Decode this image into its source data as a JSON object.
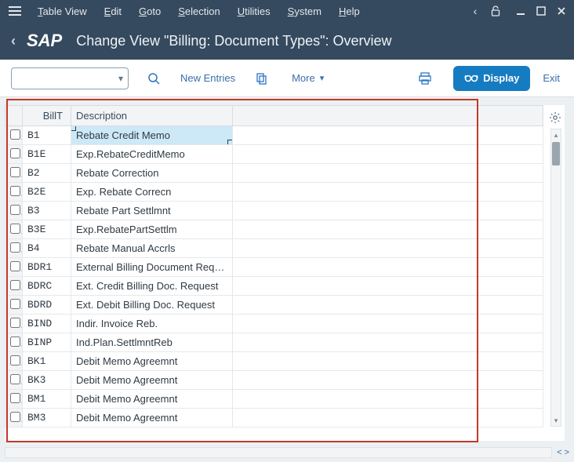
{
  "menubar": {
    "items": [
      {
        "label": "Table View",
        "ul": "T",
        "rest": "able View"
      },
      {
        "label": "Edit",
        "ul": "E",
        "rest": "dit"
      },
      {
        "label": "Goto",
        "ul": "G",
        "rest": "oto"
      },
      {
        "label": "Selection",
        "ul": "S",
        "rest": "election"
      },
      {
        "label": "Utilities",
        "ul": "U",
        "rest": "tilities"
      },
      {
        "label": "System",
        "ul": "S",
        "rest": "ystem"
      },
      {
        "label": "Help",
        "ul": "H",
        "rest": "elp"
      }
    ]
  },
  "header": {
    "logo": "SAP",
    "title": "Change View \"Billing: Document Types\": Overview"
  },
  "toolbar": {
    "combo_value": "",
    "new_entries": "New Entries",
    "more": "More",
    "display": "Display",
    "exit": "Exit"
  },
  "table": {
    "columns": {
      "billt": "BillT",
      "description": "Description"
    },
    "rows": [
      {
        "billt": "B1",
        "desc": "Rebate Credit Memo",
        "selected": true
      },
      {
        "billt": "B1E",
        "desc": "Exp.RebateCreditMemo"
      },
      {
        "billt": "B2",
        "desc": "Rebate Correction"
      },
      {
        "billt": "B2E",
        "desc": "Exp. Rebate Correcn"
      },
      {
        "billt": "B3",
        "desc": "Rebate Part Settlmnt"
      },
      {
        "billt": "B3E",
        "desc": "Exp.RebatePartSettlm"
      },
      {
        "billt": "B4",
        "desc": "Rebate Manual Accrls"
      },
      {
        "billt": "BDR1",
        "desc": "External Billing Document Requ…"
      },
      {
        "billt": "BDRC",
        "desc": "Ext. Credit Billing Doc. Request"
      },
      {
        "billt": "BDRD",
        "desc": "Ext. Debit Billing Doc. Request"
      },
      {
        "billt": "BIND",
        "desc": "Indir. Invoice Reb."
      },
      {
        "billt": "BINP",
        "desc": "Ind.Plan.SettlmntReb"
      },
      {
        "billt": "BK1",
        "desc": "Debit Memo Agreemnt"
      },
      {
        "billt": "BK3",
        "desc": "Debit Memo Agreemnt"
      },
      {
        "billt": "BM1",
        "desc": "Debit Memo Agreemnt"
      },
      {
        "billt": "BM3",
        "desc": "Debit Memo Agreemnt"
      }
    ]
  }
}
